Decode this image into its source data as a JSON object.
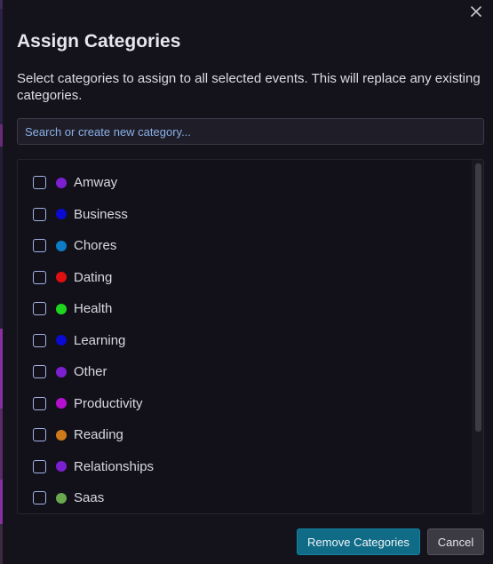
{
  "dialog": {
    "title": "Assign Categories",
    "description": "Select categories to assign to all selected events. This will replace any existing categories.",
    "close_icon": "close-icon"
  },
  "search": {
    "placeholder": "Search or create new category...",
    "value": ""
  },
  "categories": [
    {
      "label": "Amway",
      "color": "#7b1fd0",
      "checked": false
    },
    {
      "label": "Business",
      "color": "#0a0ad2",
      "checked": false
    },
    {
      "label": "Chores",
      "color": "#0e7bc6",
      "checked": false
    },
    {
      "label": "Dating",
      "color": "#e00f0f",
      "checked": false
    },
    {
      "label": "Health",
      "color": "#1ed61e",
      "checked": false
    },
    {
      "label": "Learning",
      "color": "#0a0ad2",
      "checked": false
    },
    {
      "label": "Other",
      "color": "#7b1fd0",
      "checked": false
    },
    {
      "label": "Productivity",
      "color": "#b60fd0",
      "checked": false
    },
    {
      "label": "Reading",
      "color": "#cf7a1a",
      "checked": false
    },
    {
      "label": "Relationships",
      "color": "#7b1fd0",
      "checked": false
    },
    {
      "label": "Saas",
      "color": "#6aa84f",
      "checked": false
    }
  ],
  "actions": {
    "primary_label": "Remove Categories",
    "cancel_label": "Cancel"
  },
  "colors": {
    "primary": "#0f6b86",
    "background": "#14131c",
    "checkbox_border": "#a4b2e6"
  }
}
